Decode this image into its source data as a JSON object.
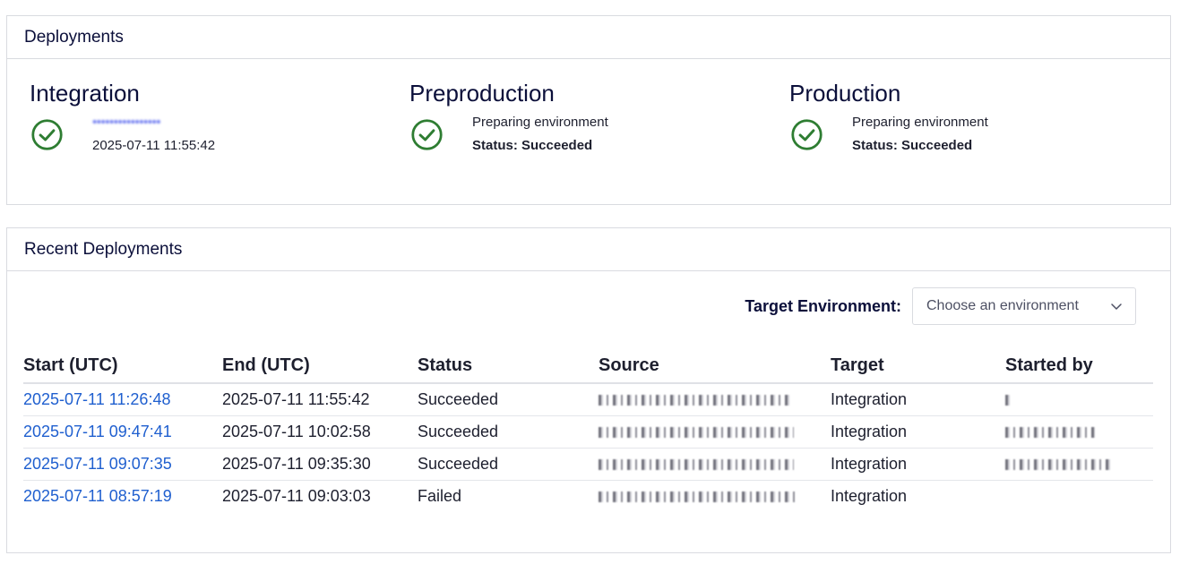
{
  "deployments": {
    "title": "Deployments",
    "environments": [
      {
        "name": "Integration",
        "line1": "••••••••••••••••",
        "line2": "2025-07-11 11:55:42",
        "icon": "check-circle-icon"
      },
      {
        "name": "Preproduction",
        "line1": "Preparing environment",
        "line2": "Status: Succeeded",
        "icon": "check-circle-icon"
      },
      {
        "name": "Production",
        "line1": "Preparing environment",
        "line2": "Status: Succeeded",
        "icon": "check-circle-icon"
      }
    ]
  },
  "recent": {
    "title": "Recent Deployments",
    "filter": {
      "label": "Target Environment:",
      "placeholder": "Choose an environment",
      "icon": "chevron-down-icon"
    },
    "columns": [
      "Start (UTC)",
      "End (UTC)",
      "Status",
      "Source",
      "Target",
      "Started by"
    ],
    "rows": [
      {
        "start": "2025-07-11 11:26:48",
        "end": "2025-07-11 11:55:42",
        "status": "Succeeded",
        "target": "Integration"
      },
      {
        "start": "2025-07-11 09:47:41",
        "end": "2025-07-11 10:02:58",
        "status": "Succeeded",
        "target": "Integration"
      },
      {
        "start": "2025-07-11 09:07:35",
        "end": "2025-07-11 09:35:30",
        "status": "Succeeded",
        "target": "Integration"
      },
      {
        "start": "2025-07-11 08:57:19",
        "end": "2025-07-11 09:03:03",
        "status": "Failed",
        "target": "Integration"
      }
    ]
  },
  "colors": {
    "success": "#2e7d32",
    "link": "#1f5fcf",
    "text": "#0b0f3a",
    "border": "#d9dbe0"
  }
}
